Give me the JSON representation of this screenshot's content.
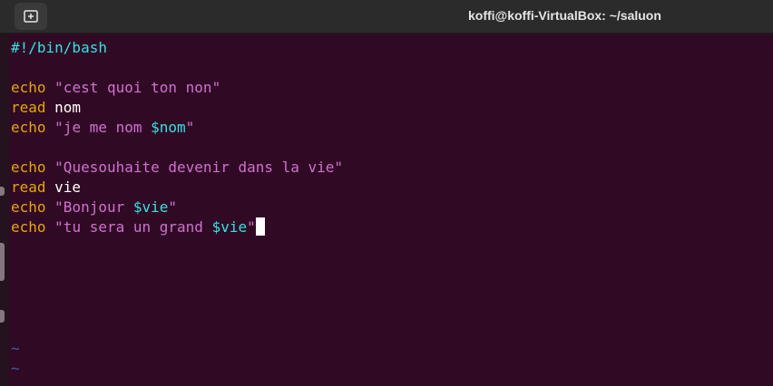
{
  "window": {
    "title": "koffi@koffi-VirtualBox: ~/saluon",
    "new_tab_icon": "new-tab-icon"
  },
  "editor": {
    "lines": [
      [
        {
          "t": "#!/bin/bash",
          "k": "comment"
        }
      ],
      [],
      [
        {
          "t": "echo",
          "k": "kw"
        },
        {
          "t": " ",
          "k": "plain"
        },
        {
          "t": "\"cest quoi ton non\"",
          "k": "str"
        }
      ],
      [
        {
          "t": "read",
          "k": "kw"
        },
        {
          "t": " nom",
          "k": "plain"
        }
      ],
      [
        {
          "t": "echo",
          "k": "kw"
        },
        {
          "t": " ",
          "k": "plain"
        },
        {
          "t": "\"je me nom ",
          "k": "str"
        },
        {
          "t": "$nom",
          "k": "var"
        },
        {
          "t": "\"",
          "k": "str"
        }
      ],
      [],
      [
        {
          "t": "echo",
          "k": "kw"
        },
        {
          "t": " ",
          "k": "plain"
        },
        {
          "t": "\"Quesouhaite devenir dans la vie\"",
          "k": "str"
        }
      ],
      [
        {
          "t": "read",
          "k": "kw"
        },
        {
          "t": " vie",
          "k": "plain"
        }
      ],
      [
        {
          "t": "echo",
          "k": "kw"
        },
        {
          "t": " ",
          "k": "plain"
        },
        {
          "t": "\"Bonjour ",
          "k": "str"
        },
        {
          "t": "$vie",
          "k": "var"
        },
        {
          "t": "\"",
          "k": "str"
        }
      ],
      [
        {
          "t": "echo",
          "k": "kw"
        },
        {
          "t": " ",
          "k": "plain"
        },
        {
          "t": "\"tu sera un grand ",
          "k": "str"
        },
        {
          "t": "$vie",
          "k": "var"
        },
        {
          "t": "\"",
          "k": "str"
        }
      ]
    ],
    "cursor_line": 9,
    "empty_line_marker": "~",
    "empty_line_markers": 2
  },
  "colors": {
    "background": "#300a24",
    "keyword": "#e5a50a",
    "string": "#d070d0",
    "variable": "#34e2e2",
    "shebang": "#34e2e2",
    "tilde": "#3465a4"
  }
}
